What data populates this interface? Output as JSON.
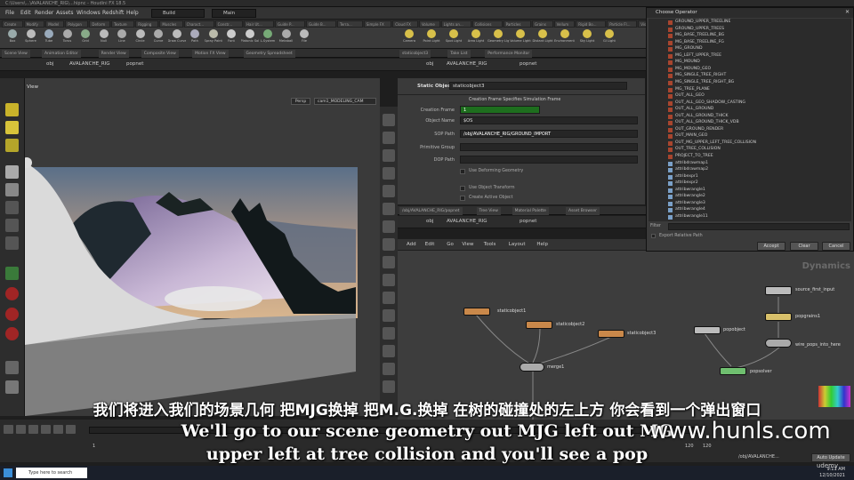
{
  "titlebar": {
    "text": "C:\\Users\\...\\AVALANCHE_RIG\\...hipnc - Houdini FX 18.5"
  },
  "menubar": {
    "items": [
      "File",
      "Edit",
      "Render",
      "Assets",
      "Windows",
      "Redshift",
      "Help"
    ],
    "desktop": "Build",
    "main": "Main"
  },
  "shelf_tabs": [
    "Create",
    "Modify",
    "Model",
    "Polygon",
    "Deform",
    "Texture",
    "Rigging",
    "Muscles",
    "Charact...",
    "Constr...",
    "Hair Ut...",
    "Guide P...",
    "Guide B...",
    "Terra...",
    "Simple FX",
    "Cloud FX",
    "Volume",
    "Lights an...",
    "Collisions",
    "Particles",
    "Grains",
    "Vellum",
    "Rigid Bo...",
    "Particle Fl...",
    "Viscous F...",
    "Oceans",
    "Fluid Con..."
  ],
  "shelf_tools_left": [
    "Box",
    "Sphere",
    "Tube",
    "Torus",
    "Grid",
    "Null",
    "Line",
    "Circle",
    "Curve",
    "Draw Curve",
    "Path",
    "Spray Paint",
    "Font",
    "Platonic Solids",
    "L-System",
    "Metaball",
    "File"
  ],
  "shelf_tools_right": [
    "Camera",
    "Point Light",
    "Spot Light",
    "Area Light",
    "Geometry Light",
    "Volume Light",
    "Distant Light",
    "Environment Light",
    "Sky Light",
    "GI Light"
  ],
  "scene_tabs": [
    "Scene View",
    "Animation Editor",
    "Render View",
    "Composite View",
    "Motion FX View",
    "Geometry Spreadsheet"
  ],
  "path": {
    "obj": "obj",
    "rig": "AVALANCHE_RIG",
    "node": "popnet"
  },
  "viewport": {
    "label": "View",
    "persp": "Persp",
    "cam": "cam1_MODELING_CAM"
  },
  "param_tabs": [
    "staticobject3",
    "Take List",
    "Performance Monitor"
  ],
  "params": {
    "type": "Static Object",
    "name": "staticobject3",
    "creation_frame_label": "Creation Frame Specifies Simulation Frame",
    "creation_frame": "1",
    "object_name_label": "Object Name",
    "object_name": "$OS",
    "sop_path_label": "SOP Path",
    "sop_path": "/obj/AVALANCHE_RIG/GROUND_IMPORT",
    "primitive_group_label": "Primitive Group",
    "dop_path_label": "DOP Path",
    "checks": [
      "Use Deforming Geometry",
      "Use Object Transform",
      "Create Active Object"
    ]
  },
  "network_tabs": [
    "/obj/AVALANCHE_RIG/popnet",
    "Tree View",
    "Material Palette",
    "Asset Browser"
  ],
  "network_menu": [
    "Add",
    "Edit",
    "Go",
    "View",
    "Tools",
    "Layout",
    "Help"
  ],
  "network_label": "Dynamics",
  "nodes": {
    "static1": "staticobject1",
    "static2": "staticobject2",
    "static3": "staticobject3",
    "merge": "merge1",
    "popobject": "popobject",
    "source": "source_first_input",
    "popgrains": "popgrains1",
    "wire": "wire_pops_into_here",
    "popsolver": "popsolver"
  },
  "dialog": {
    "title": "Choose Operator",
    "items": [
      "GROUND_UPPER_TREELINE",
      "GROUND_UPPER_TREES",
      "MG_BASE_TREELINE_BG",
      "MG_BASE_TREELINE_FG",
      "MG_GROUND",
      "MG_LEFT_UPPER_TREE",
      "MG_MOUND",
      "MG_MOUND_GEO",
      "MG_SINGLE_TREE_RIGHT",
      "MG_SINGLE_TREE_RIGHT_BG",
      "MG_TREE_PLANE",
      "OUT_ALL_GEO",
      "OUT_ALL_GEO_SHADOW_CASTING",
      "OUT_ALL_GROUND",
      "OUT_ALL_GROUND_THICK",
      "OUT_ALL_GROUND_THICK_VDB",
      "OUT_GROUND_RENDER",
      "OUT_MAIN_GEO",
      "OUT_MG_UPPER_LEFT_TREE_COLLISION",
      "OUT_TREE_COLLISION",
      "PROJECT_TO_TREE",
      "attribdrawmap1",
      "attribdrawmap2",
      "attribexpr1",
      "attribexpr2",
      "attribwrangle1",
      "attribwrangle2",
      "attribwrangle3",
      "attribwrangle4",
      "attribwrangle11"
    ],
    "filter": "Filter",
    "export_relative": "Export Relative Path",
    "accept": "Accept",
    "clear": "Clear",
    "cancel": "Cancel"
  },
  "timeline": {
    "frame_start": "1",
    "frame_end": "120",
    "frame_end2": "120",
    "auto_update": "Auto Update",
    "path": "/obj/AVALANCHE..."
  },
  "taskbar": {
    "search": "Type here to search",
    "time": "9:11 AM",
    "date": "12/10/2021"
  },
  "subtitles": {
    "cn": "我们将进入我们的场景几何 把MJG换掉 把M.G.换掉 在树的碰撞处的左上方 你会看到一个弹出窗口",
    "en1": "We'll go to our scene geometry out MJG left out MG",
    "en2": "upper left at tree collision and you'll see a pop"
  },
  "watermark": "www.hunls.com",
  "udemy": "udemy"
}
